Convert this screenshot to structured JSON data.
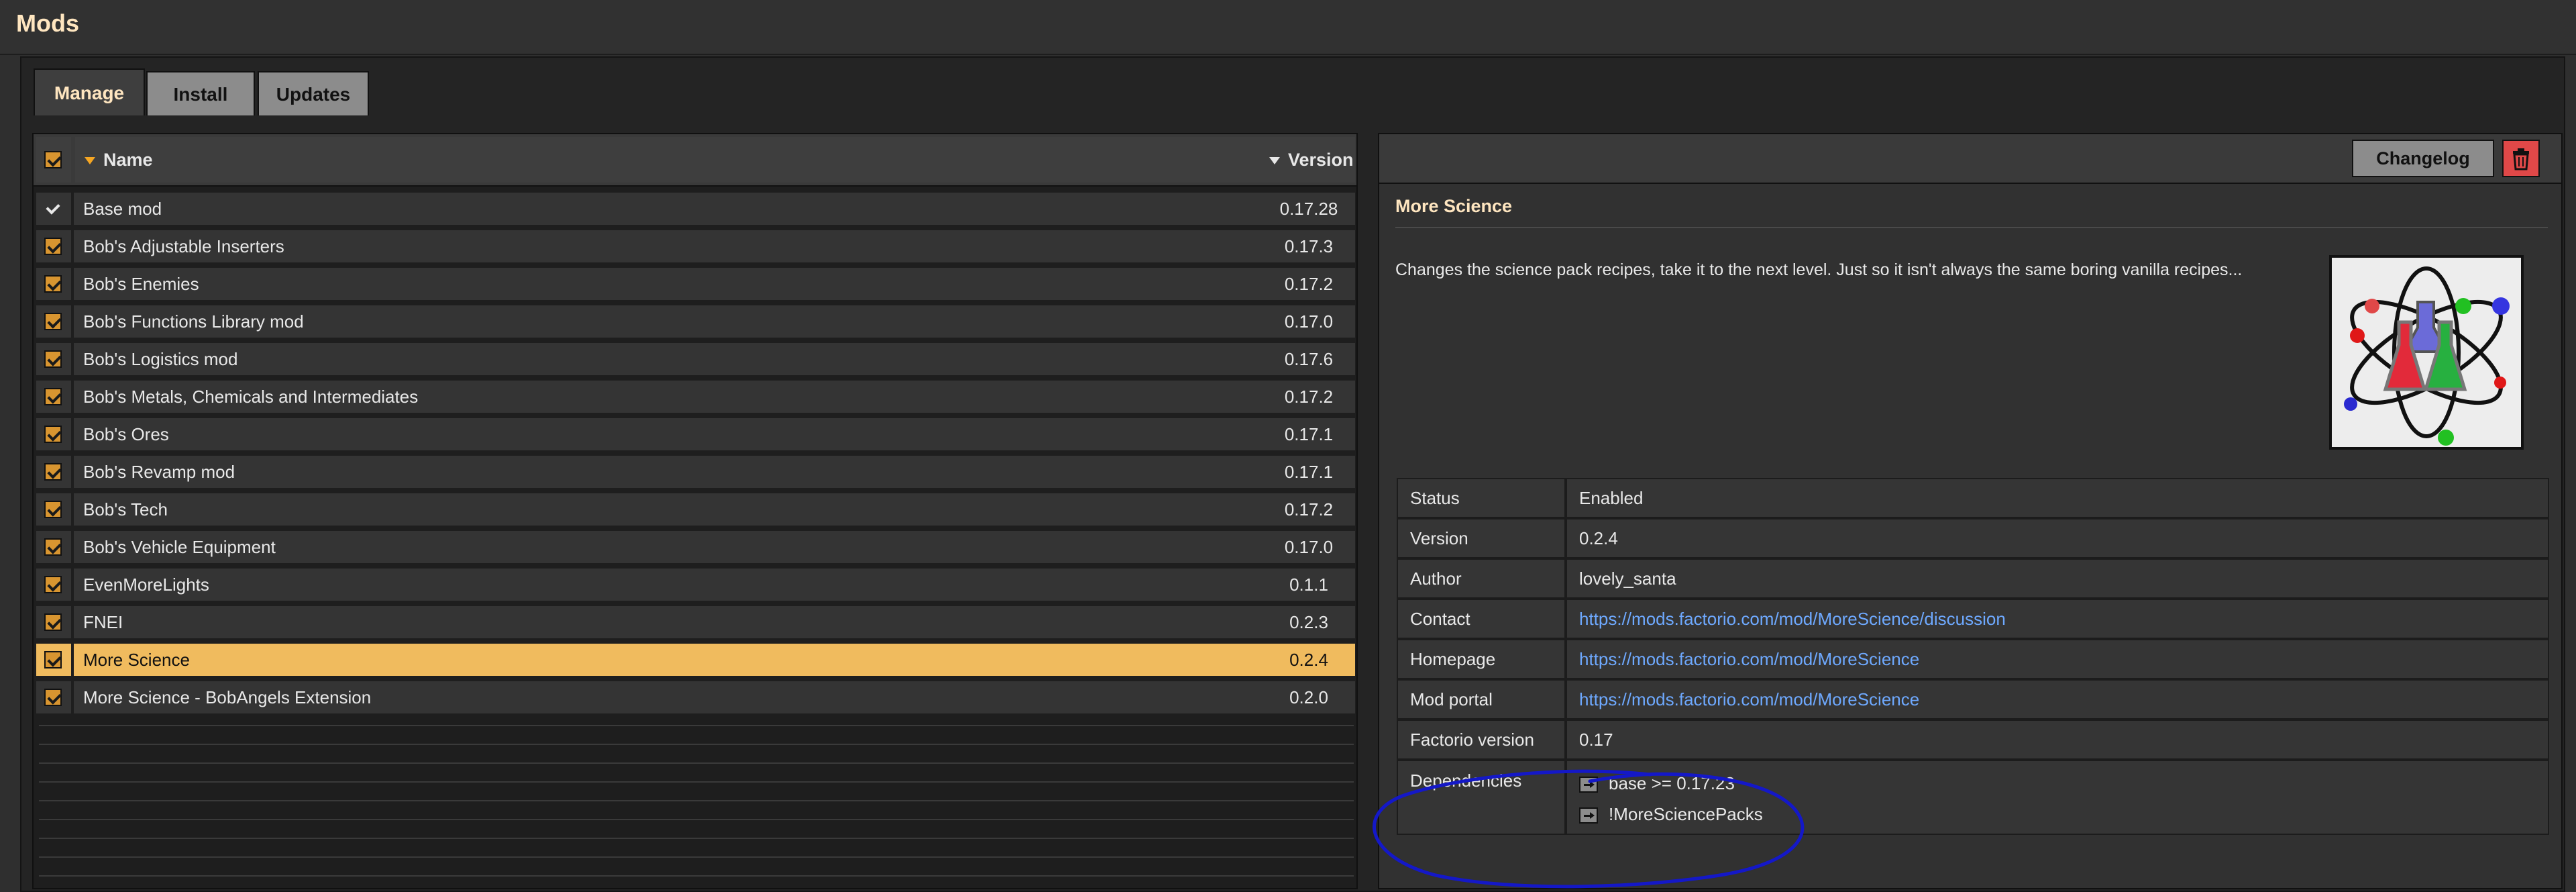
{
  "window": {
    "title": "Mods"
  },
  "tabs": [
    {
      "label": "Manage",
      "active": true
    },
    {
      "label": "Install",
      "active": false
    },
    {
      "label": "Updates",
      "active": false
    }
  ],
  "modlist": {
    "header": {
      "name": "Name",
      "version": "Version"
    },
    "rows": [
      {
        "name": "Base mod",
        "version": "0.17.28",
        "checkbox": "gray-check"
      },
      {
        "name": "Bob's Adjustable Inserters",
        "version": "0.17.3"
      },
      {
        "name": "Bob's Enemies",
        "version": "0.17.2"
      },
      {
        "name": "Bob's Functions Library mod",
        "version": "0.17.0"
      },
      {
        "name": "Bob's Logistics mod",
        "version": "0.17.6"
      },
      {
        "name": "Bob's Metals, Chemicals and Intermediates",
        "version": "0.17.2"
      },
      {
        "name": "Bob's Ores",
        "version": "0.17.1"
      },
      {
        "name": "Bob's Revamp mod",
        "version": "0.17.1"
      },
      {
        "name": "Bob's Tech",
        "version": "0.17.2"
      },
      {
        "name": "Bob's Vehicle Equipment",
        "version": "0.17.0"
      },
      {
        "name": "EvenMoreLights",
        "version": "0.1.1"
      },
      {
        "name": "FNEI",
        "version": "0.2.3"
      },
      {
        "name": "More Science",
        "version": "0.2.4",
        "selected": true
      },
      {
        "name": "More Science - BobAngels Extension",
        "version": "0.2.0"
      }
    ]
  },
  "details": {
    "changelog_label": "Changelog",
    "delete_icon": "trash-icon",
    "title": "More Science",
    "description": "Changes the science pack recipes, take it to the next level. Just so it isn't always the same boring vanilla recipes...",
    "thumbnail": "science-flasks-atom-icon",
    "info": {
      "status_label": "Status",
      "status": "Enabled",
      "version_label": "Version",
      "version": "0.2.4",
      "author_label": "Author",
      "author": "lovely_santa",
      "contact_label": "Contact",
      "contact": "https://mods.factorio.com/mod/MoreScience/discussion",
      "homepage_label": "Homepage",
      "homepage": "https://mods.factorio.com/mod/MoreScience",
      "modportal_label": "Mod portal",
      "modportal": "https://mods.factorio.com/mod/MoreScience",
      "factorio_label": "Factorio version",
      "factorio": "0.17",
      "deps_label": "Dependencies",
      "deps": [
        "base >= 0.17.23",
        "!MoreSciencePacks"
      ]
    }
  },
  "colors": {
    "accent": "#f0bb5e",
    "link": "#6ea9ff",
    "annotation": "#1418c8"
  }
}
